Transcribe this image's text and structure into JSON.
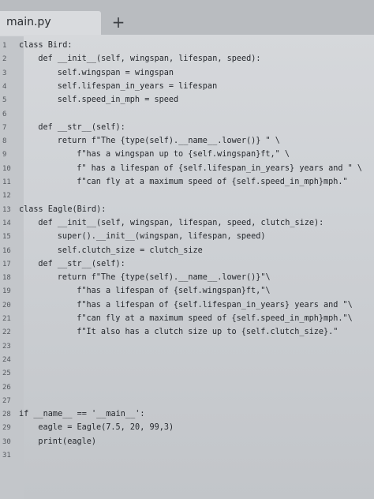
{
  "tab": {
    "filename": "main.py",
    "add_symbol": "+"
  },
  "lines": [
    {
      "n": "1",
      "indent": 0,
      "text": "class Bird:"
    },
    {
      "n": "2",
      "indent": 2,
      "text": "def __init__(self, wingspan, lifespan, speed):"
    },
    {
      "n": "3",
      "indent": 4,
      "text": "self.wingspan = wingspan"
    },
    {
      "n": "4",
      "indent": 4,
      "text": "self.lifespan_in_years = lifespan"
    },
    {
      "n": "5",
      "indent": 4,
      "text": "self.speed_in_mph = speed"
    },
    {
      "n": "6",
      "indent": 0,
      "text": ""
    },
    {
      "n": "7",
      "indent": 2,
      "text": "def __str__(self):"
    },
    {
      "n": "8",
      "indent": 4,
      "text": "return f\"The {type(self).__name__.lower()} \" \\"
    },
    {
      "n": "9",
      "indent": 6,
      "text": "f\"has a wingspan up to {self.wingspan}ft,\" \\"
    },
    {
      "n": "10",
      "indent": 6,
      "text": "f\" has a lifespan of {self.lifespan_in_years} years and \" \\"
    },
    {
      "n": "11",
      "indent": 6,
      "text": "f\"can fly at a maximum speed of {self.speed_in_mph}mph.\""
    },
    {
      "n": "12",
      "indent": 0,
      "text": ""
    },
    {
      "n": "13",
      "indent": 0,
      "text": "class Eagle(Bird):"
    },
    {
      "n": "14",
      "indent": 2,
      "text": "def __init__(self, wingspan, lifespan, speed, clutch_size):"
    },
    {
      "n": "15",
      "indent": 4,
      "text": "super().__init__(wingspan, lifespan, speed)"
    },
    {
      "n": "16",
      "indent": 4,
      "text": "self.clutch_size = clutch_size"
    },
    {
      "n": "17",
      "indent": 2,
      "text": "def __str__(self):"
    },
    {
      "n": "18",
      "indent": 4,
      "text": "return f\"The {type(self).__name__.lower()}\"\\"
    },
    {
      "n": "19",
      "indent": 6,
      "text": "f\"has a lifespan of {self.wingspan}ft,\"\\"
    },
    {
      "n": "20",
      "indent": 6,
      "text": "f\"has a lifespan of {self.lifespan_in_years} years and \"\\"
    },
    {
      "n": "21",
      "indent": 6,
      "text": "f\"can fly at a maximum speed of {self.speed_in_mph}mph.\"\\"
    },
    {
      "n": "22",
      "indent": 6,
      "text": "f\"It also has a clutch size up to {self.clutch_size}.\""
    },
    {
      "n": "23",
      "indent": 0,
      "text": ""
    },
    {
      "n": "24",
      "indent": 0,
      "text": ""
    },
    {
      "n": "25",
      "indent": 0,
      "text": ""
    },
    {
      "n": "26",
      "indent": 0,
      "text": ""
    },
    {
      "n": "27",
      "indent": 0,
      "text": ""
    },
    {
      "n": "28",
      "indent": 0,
      "text": "if __name__ == '__main__':"
    },
    {
      "n": "29",
      "indent": 2,
      "text": "eagle = Eagle(7.5, 20, 99,3)"
    },
    {
      "n": "30",
      "indent": 2,
      "text": "print(eagle)"
    },
    {
      "n": "31",
      "indent": 0,
      "text": ""
    }
  ]
}
